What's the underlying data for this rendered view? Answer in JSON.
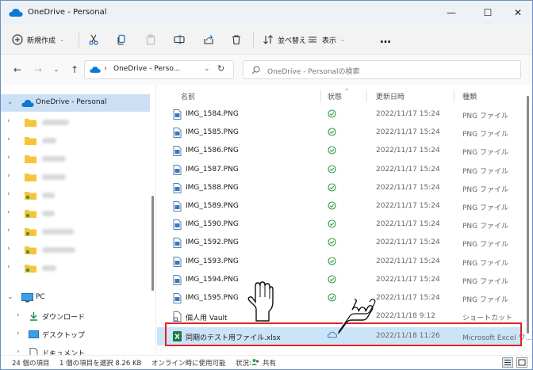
{
  "window": {
    "title": "OneDrive - Personal",
    "controls": [
      "—",
      "☐",
      "✕"
    ]
  },
  "commandbar": {
    "new_label": "新規作成",
    "sort_label": "並べ替え",
    "view_label": "表示",
    "more_label": "…"
  },
  "address": {
    "path": "OneDrive - Perso...",
    "search_placeholder": "OneDrive - Personalの検索"
  },
  "nav": {
    "onedrive_label": "OneDrive - Personal",
    "pc_label": "PC",
    "downloads_label": "ダウンロード",
    "desktop_label": "デスクトップ",
    "documents_label": "ドキュメント"
  },
  "columns": {
    "name": "名前",
    "status": "状態",
    "modified": "更新日時",
    "type": "種類"
  },
  "files": [
    {
      "name": "IMG_1584.PNG",
      "date": "2022/11/17 15:24",
      "type": "PNG ファイル"
    },
    {
      "name": "IMG_1585.PNG",
      "date": "2022/11/17 15:24",
      "type": "PNG ファイル"
    },
    {
      "name": "IMG_1586.PNG",
      "date": "2022/11/17 15:24",
      "type": "PNG ファイル"
    },
    {
      "name": "IMG_1587.PNG",
      "date": "2022/11/17 15:24",
      "type": "PNG ファイル"
    },
    {
      "name": "IMG_1588.PNG",
      "date": "2022/11/17 15:24",
      "type": "PNG ファイル"
    },
    {
      "name": "IMG_1589.PNG",
      "date": "2022/11/17 15:24",
      "type": "PNG ファイル"
    },
    {
      "name": "IMG_1590.PNG",
      "date": "2022/11/17 15:24",
      "type": "PNG ファイル"
    },
    {
      "name": "IMG_1592.PNG",
      "date": "2022/11/17 15:24",
      "type": "PNG ファイル"
    },
    {
      "name": "IMG_1593.PNG",
      "date": "2022/11/17 15:24",
      "type": "PNG ファイル"
    },
    {
      "name": "IMG_1594.PNG",
      "date": "2022/11/17 15:24",
      "type": "PNG ファイル"
    },
    {
      "name": "IMG_1595.PNG",
      "date": "2022/11/17 15:24",
      "type": "PNG ファイル"
    },
    {
      "name": "個人用 Vault",
      "date": "2022/11/18 9:12",
      "type": "ショートカット"
    },
    {
      "name": "同期のテスト用ファイル.xlsx",
      "date": "2022/11/18 11:26",
      "type": "Microsoft Excel ワ..."
    }
  ],
  "statusbar": {
    "count": "24 個の項目",
    "selected": "1 個の項目を選択  8.26 KB",
    "offline": "オンライン時に使用可能",
    "status_label": "状況:",
    "shared": "共有"
  },
  "colors": {
    "accent": "#0063b1",
    "onedrive_blue": "#0f78d4",
    "folder_yellow": "#f8c33a",
    "synced_green": "#2e9a4a",
    "highlight_red": "#e02424",
    "selection": "#cce4f7"
  }
}
